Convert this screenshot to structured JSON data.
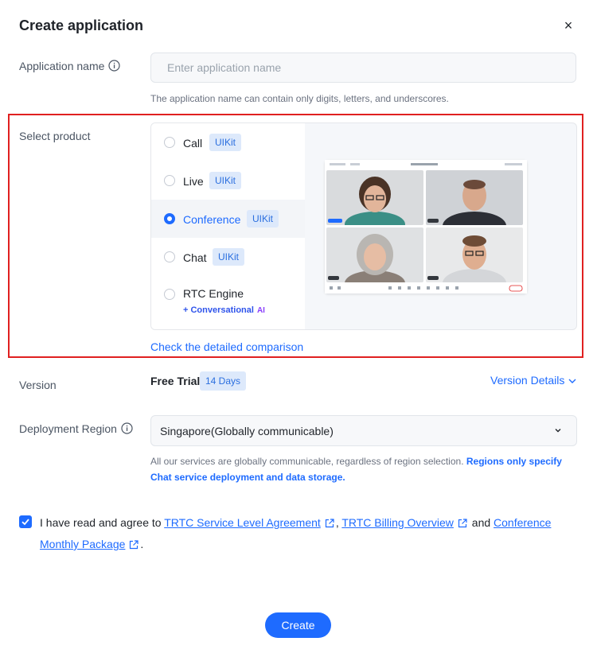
{
  "dialog": {
    "title": "Create application",
    "close_label": "×"
  },
  "app_name": {
    "label": "Application name",
    "placeholder": "Enter application name",
    "value": "",
    "hint": "The application name can contain only digits, letters, and underscores."
  },
  "product": {
    "label": "Select product",
    "items": [
      {
        "name": "Call",
        "badge": "UIKit",
        "selected": false
      },
      {
        "name": "Live",
        "badge": "UIKit",
        "selected": false
      },
      {
        "name": "Conference",
        "badge": "UIKit",
        "selected": true
      },
      {
        "name": "Chat",
        "badge": "UIKit",
        "selected": false
      },
      {
        "name": "RTC Engine",
        "badge": "",
        "selected": false,
        "sub": "+ Conversational",
        "sub_mark": "AI"
      }
    ],
    "compare_link": "Check the detailed comparison"
  },
  "version": {
    "label": "Version",
    "plan": "Free Trial",
    "days_badge": "14 Days",
    "details_link": "Version Details"
  },
  "region": {
    "label": "Deployment Region",
    "selected": "Singapore(Globally communicable)",
    "note_plain": "All our services are globally communicable, regardless of region selection. ",
    "note_bold": "Regions only specify Chat service deployment and data storage."
  },
  "agreement": {
    "checked": true,
    "prefix": "I have read and agree to ",
    "link1": "TRTC Service Level Agreement",
    "sep1": ", ",
    "link2": "TRTC Billing Overview",
    "sep2": " and ",
    "link3": "Conference Monthly Package",
    "suffix": "."
  },
  "actions": {
    "create_label": "Create"
  },
  "colors": {
    "accent": "#1e6bff",
    "highlight_border": "#e02020",
    "badge_bg": "#dde9fb"
  }
}
